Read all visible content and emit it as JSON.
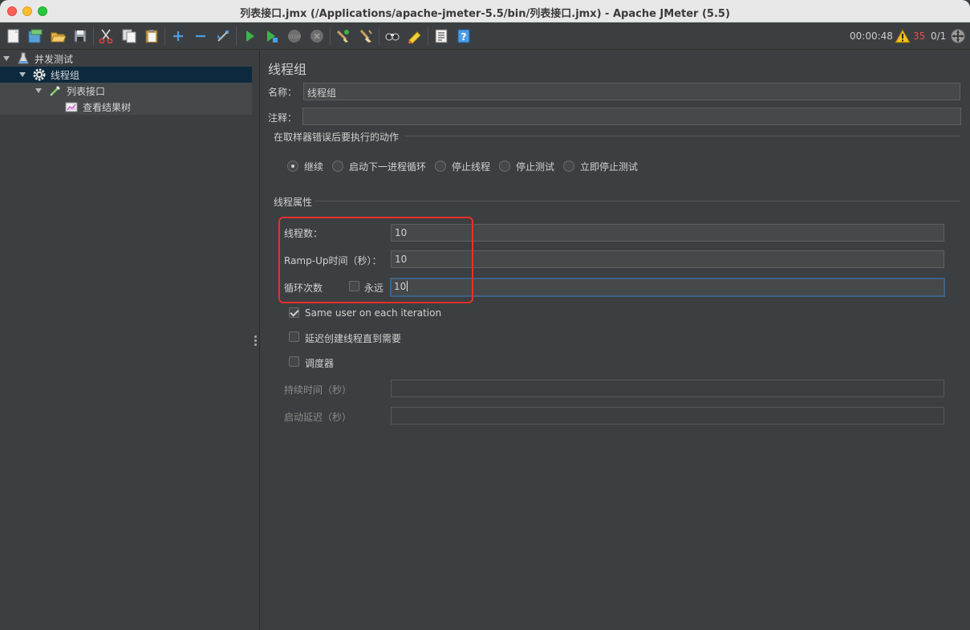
{
  "window": {
    "title": "列表接口.jmx (/Applications/apache-jmeter-5.5/bin/列表接口.jmx) - Apache JMeter (5.5)"
  },
  "toolbar": {
    "icons": [
      "new-icon",
      "templates-icon",
      "open-icon",
      "save-icon",
      "cut-icon",
      "copy-icon",
      "paste-icon",
      "expand-icon",
      "collapse-icon",
      "toggle-icon",
      "start-icon",
      "start-no-pause-icon",
      "stop-icon",
      "shutdown-icon",
      "clear-icon",
      "clear-all-icon",
      "search-icon",
      "reset-search-icon",
      "function-helper-icon",
      "help-icon"
    ],
    "elapsed_time": "00:00:48",
    "warning_count": "35",
    "active_threads": "0/1"
  },
  "tree": {
    "items": [
      {
        "label": "并发测试",
        "icon": "test-plan-icon"
      },
      {
        "label": "线程组",
        "icon": "gear-icon"
      },
      {
        "label": "列表接口",
        "icon": "pipette-icon"
      },
      {
        "label": "查看结果树",
        "icon": "results-tree-icon"
      }
    ]
  },
  "panel": {
    "title": "线程组",
    "name_label": "名称：",
    "name_value": "线程组",
    "comment_label": "注释：",
    "comment_value": "",
    "error_action_title": "在取样器错误后要执行的动作",
    "error_actions": [
      {
        "label": "继续",
        "selected": true
      },
      {
        "label": "启动下一进程循环",
        "selected": false
      },
      {
        "label": "停止线程",
        "selected": false
      },
      {
        "label": "停止测试",
        "selected": false
      },
      {
        "label": "立即停止测试",
        "selected": false
      }
    ],
    "thread_props_title": "线程属性",
    "thread_count_label": "线程数：",
    "thread_count_value": "10",
    "rampup_label": "Ramp-Up时间（秒）：",
    "rampup_value": "10",
    "loop_label": "循环次数",
    "forever_label": "永远",
    "forever_checked": false,
    "loop_value": "10",
    "same_user_label": "Same user on each iteration",
    "same_user_checked": true,
    "delay_create_label": "延迟创建线程直到需要",
    "delay_create_checked": false,
    "scheduler_label": "调度器",
    "scheduler_checked": false,
    "duration_label": "持续时间（秒）",
    "duration_value": "",
    "startup_delay_label": "启动延迟（秒）",
    "startup_delay_value": ""
  },
  "colors": {
    "background": "#3c3f41",
    "selection": "#0d293e",
    "highlight_box": "#e8302a",
    "focus_border": "#3d6185"
  }
}
